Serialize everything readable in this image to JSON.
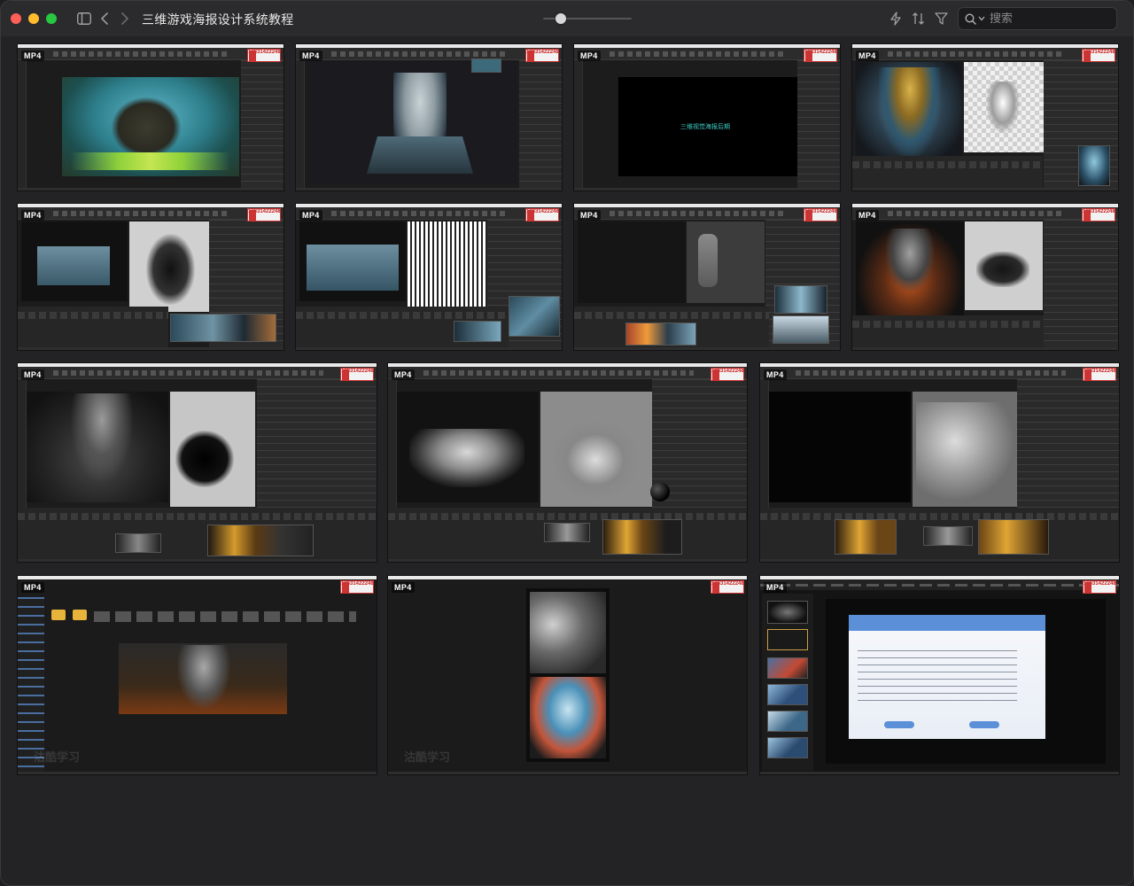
{
  "window": {
    "title": "三维游戏海报设计系统教程",
    "zoom_level": 0.2
  },
  "toolbar": {
    "sidebar_icon": "sidebar-icon",
    "back_icon": "chevron-left-icon",
    "forward_icon": "chevron-right-icon",
    "quick_action_icon": "bolt-icon",
    "sort_icon": "sort-icon",
    "filter_icon": "filter-icon"
  },
  "search": {
    "placeholder": "搜索"
  },
  "thumbnails": [
    {
      "tag": "MP4",
      "badge": "18831422248"
    },
    {
      "tag": "MP4",
      "badge": "18831422248"
    },
    {
      "tag": "MP4",
      "badge": "18831422248",
      "caption": "三维视觉海报后期"
    },
    {
      "tag": "MP4",
      "badge": "18831422248"
    },
    {
      "tag": "MP4",
      "badge": "18831422248"
    },
    {
      "tag": "MP4",
      "badge": "18831422248"
    },
    {
      "tag": "MP4",
      "badge": "18831422248"
    },
    {
      "tag": "MP4",
      "badge": "18831422248"
    },
    {
      "tag": "MP4",
      "badge": "18831422248"
    },
    {
      "tag": "MP4",
      "badge": "18831422248"
    },
    {
      "tag": "MP4",
      "badge": "18831422248"
    },
    {
      "tag": "MP4",
      "badge": "18831422248",
      "watermark": "沽酷学习"
    },
    {
      "tag": "MP4",
      "badge": "18831422248",
      "watermark": "沽酷学习"
    },
    {
      "tag": "MP4",
      "badge": "18831422248"
    }
  ],
  "colors": {
    "close": "#fe5f57",
    "minimize": "#febc2e",
    "maximize": "#28c840",
    "background": "#232325"
  }
}
